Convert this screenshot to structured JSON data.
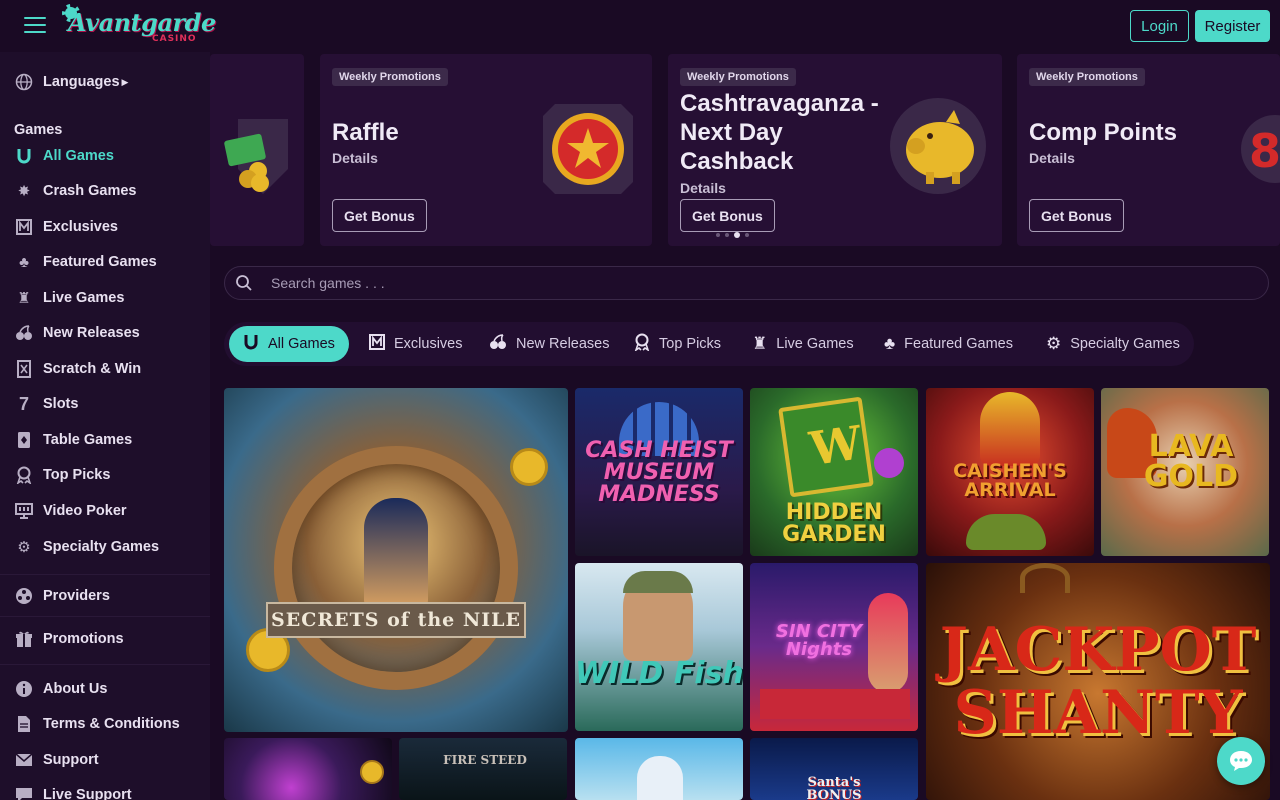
{
  "header": {
    "logo_text": "Avantgarde",
    "logo_sub": "CASINO",
    "login_label": "Login",
    "register_label": "Register"
  },
  "sidebar": {
    "languages_label": "Languages",
    "games_heading": "Games",
    "games": [
      {
        "label": "All Games",
        "icon": "horseshoe-icon",
        "active": true
      },
      {
        "label": "Crash Games",
        "icon": "explosion-icon"
      },
      {
        "label": "Exclusives",
        "icon": "exclusive-icon"
      },
      {
        "label": "Featured Games",
        "icon": "clover-icon"
      },
      {
        "label": "Live Games",
        "icon": "dealer-icon"
      },
      {
        "label": "New Releases",
        "icon": "cherries-icon"
      },
      {
        "label": "Scratch & Win",
        "icon": "scratch-card-icon"
      },
      {
        "label": "Slots",
        "icon": "seven-icon"
      },
      {
        "label": "Table Games",
        "icon": "cards-icon"
      },
      {
        "label": "Top Picks",
        "icon": "medal-icon"
      },
      {
        "label": "Video Poker",
        "icon": "monitor-icon"
      },
      {
        "label": "Specialty Games",
        "icon": "gear-icon"
      }
    ],
    "providers_label": "Providers",
    "promotions_label": "Promotions",
    "about_label": "About Us",
    "terms_label": "Terms & Conditions",
    "support_label": "Support",
    "live_support_label": "Live Support"
  },
  "promos": [
    {
      "badge": "Weekly Promotions",
      "title": "Raffle",
      "details": "Details",
      "button": "Get Bonus"
    },
    {
      "badge": "Weekly Promotions",
      "title": "Cashtravaganza - Next Day Cashback",
      "details": "Details",
      "button": "Get Bonus"
    },
    {
      "badge": "Weekly Promotions",
      "title": "Comp Points",
      "details": "Details",
      "button": "Get Bonus"
    }
  ],
  "search": {
    "placeholder": "Search games . . ."
  },
  "tabs": [
    {
      "label": "All Games",
      "icon": "horseshoe-icon"
    },
    {
      "label": "Exclusives",
      "icon": "exclusive-icon"
    },
    {
      "label": "New Releases",
      "icon": "cherries-icon"
    },
    {
      "label": "Top Picks",
      "icon": "medal-icon"
    },
    {
      "label": "Live Games",
      "icon": "dealer-icon"
    },
    {
      "label": "Featured Games",
      "icon": "clover-icon"
    },
    {
      "label": "Specialty Games",
      "icon": "gear-icon"
    }
  ],
  "games": [
    {
      "name": "SECRETS of the NILE"
    },
    {
      "name": "CASH HEIST MUSEUM MADNESS"
    },
    {
      "name": "HIDDEN GARDEN"
    },
    {
      "name": "CAISHEN'S ARRIVAL"
    },
    {
      "name": "LAVA GOLD"
    },
    {
      "name": "WILD Fishin"
    },
    {
      "name": "SIN CITY Nights"
    },
    {
      "name": "JACKPOT SHANTY"
    },
    {
      "name": ""
    },
    {
      "name": "FIRE STEED"
    },
    {
      "name": ""
    },
    {
      "name": "Santa's BONUS"
    }
  ],
  "colors": {
    "accent": "#4dd9c9",
    "background": "#1a0a24",
    "sidebar": "#1e0e2a",
    "card": "#260f34"
  }
}
